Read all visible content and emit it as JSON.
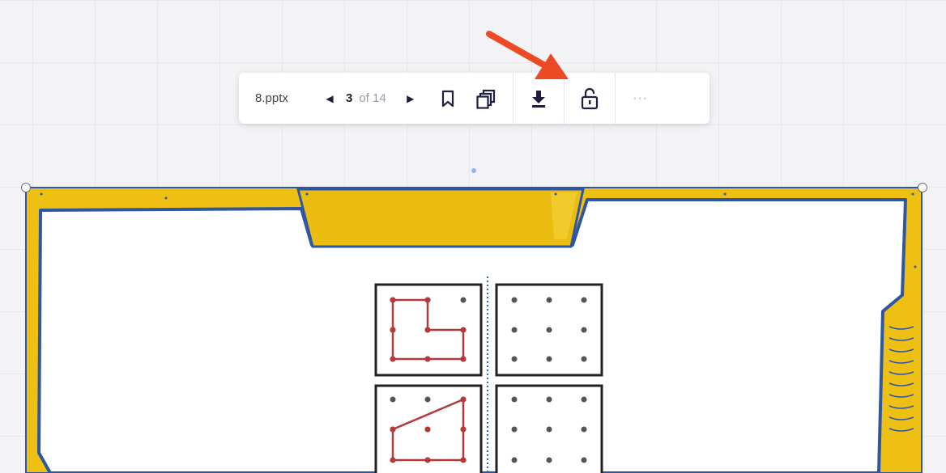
{
  "toolbar": {
    "filename": "8.pptx",
    "current_page": "3",
    "total_pages_label": "of 14",
    "more_label": "···"
  },
  "colors": {
    "frame_yellow": "#efc014",
    "frame_blue": "#2f56a3",
    "annotation_arrow": "#ec4a25",
    "shape_red": "#b23a3a"
  }
}
